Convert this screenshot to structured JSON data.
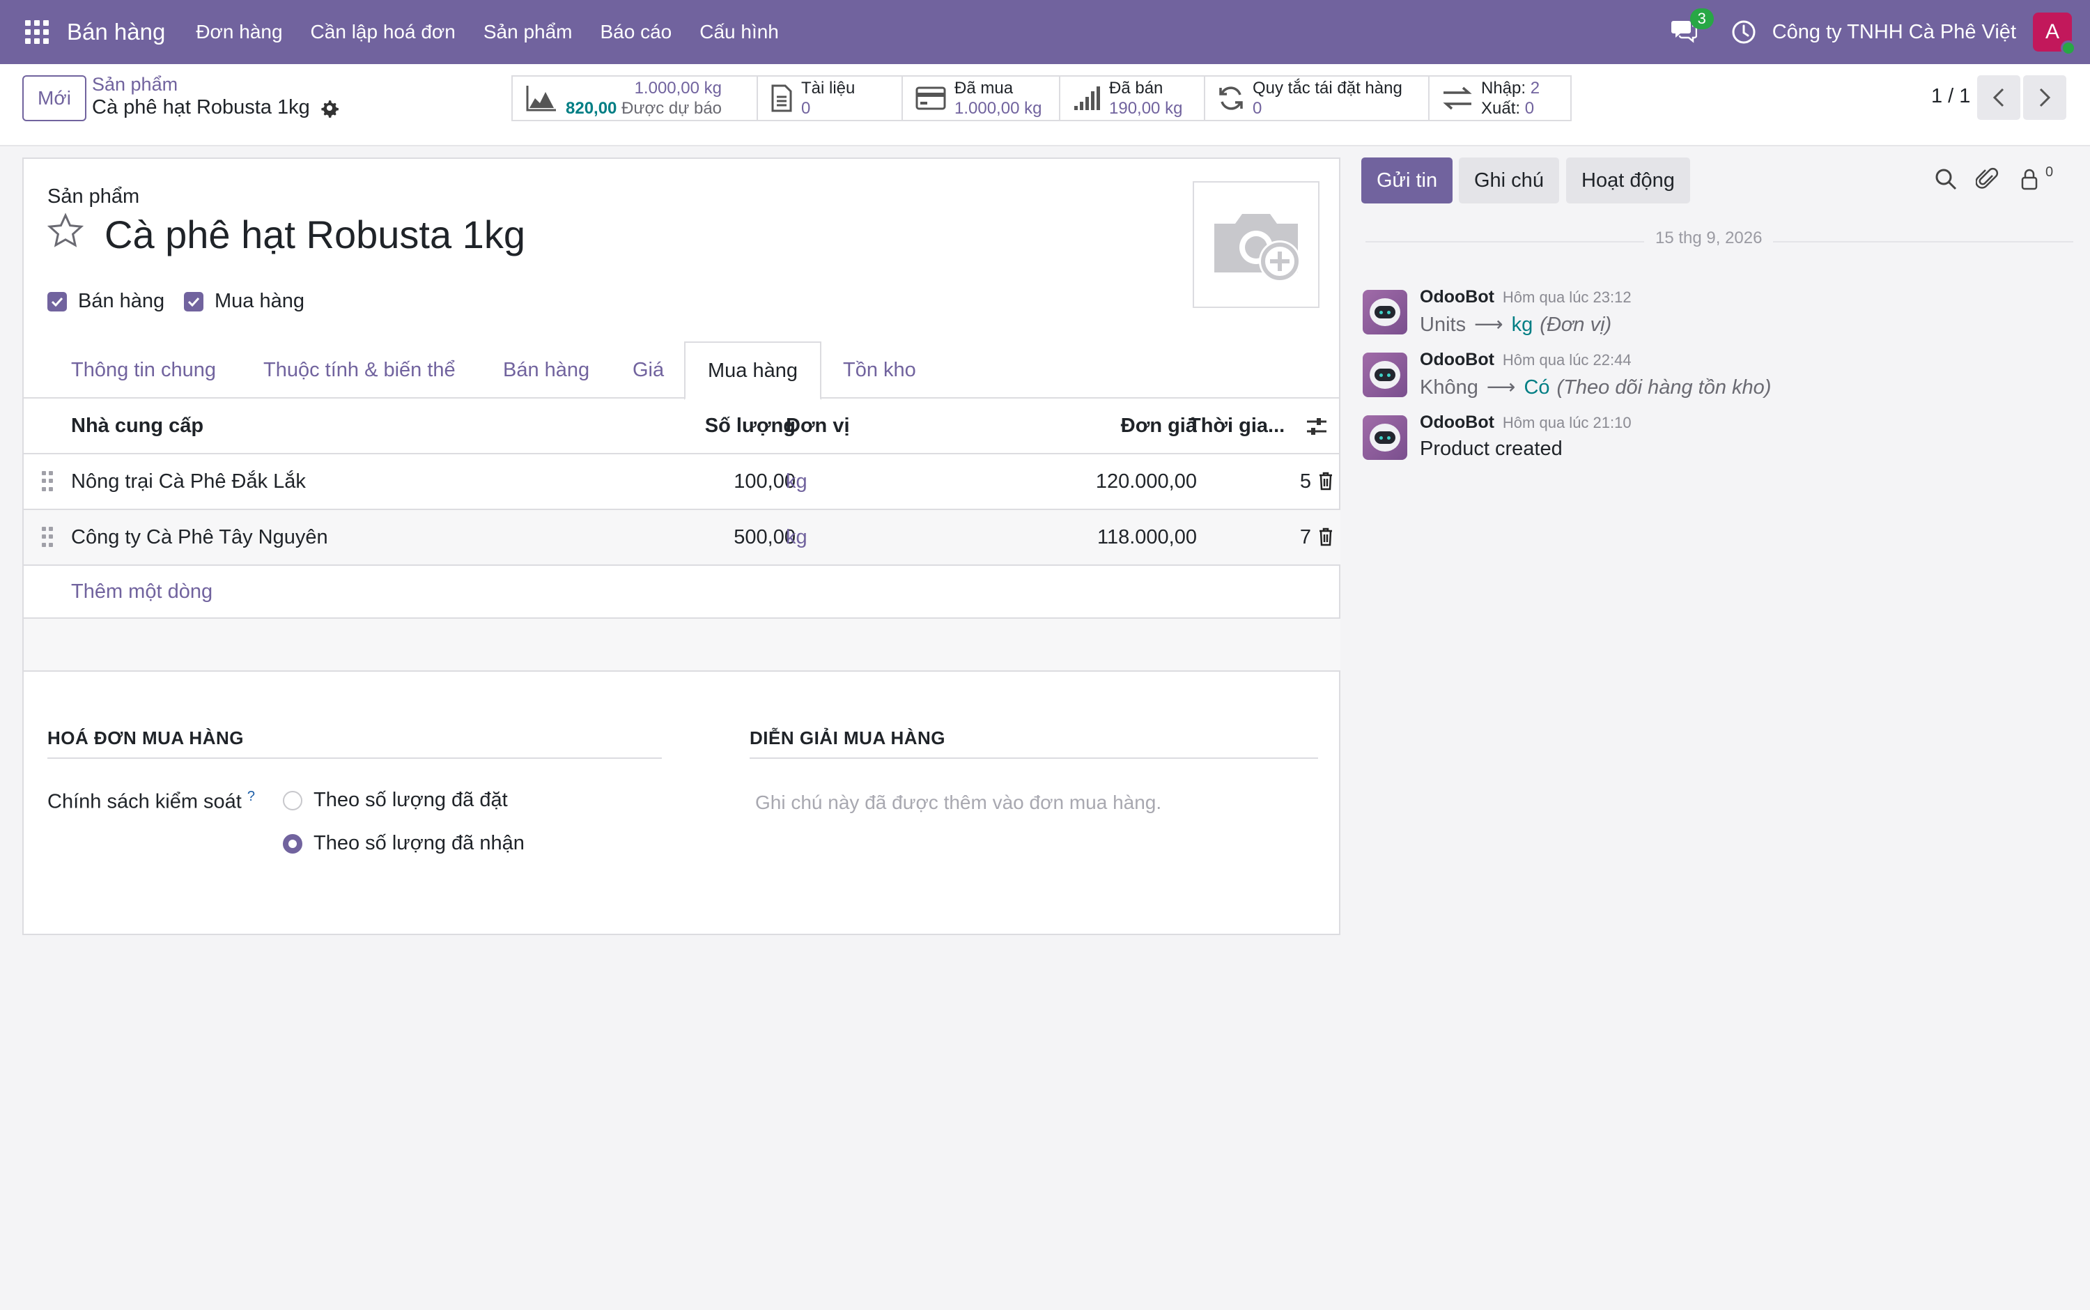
{
  "navbar": {
    "app_name": "Bán hàng",
    "menus": [
      "Đơn hàng",
      "Cần lập hoá đơn",
      "Sản phẩm",
      "Báo cáo",
      "Cấu hình"
    ],
    "message_count": "3",
    "company": "Công ty TNHH Cà Phê Việt",
    "avatar_letter": "A"
  },
  "control": {
    "new_label": "Mới",
    "breadcrumb_parent": "Sản phẩm",
    "breadcrumb_current": "Cà phê hạt Robusta 1kg",
    "smart_buttons": {
      "forecast": {
        "onhand": "1.000,00 kg",
        "forecast_value": "820,00",
        "forecast_label": "Được dự báo"
      },
      "documents": {
        "label": "Tài liệu",
        "value": "0"
      },
      "purchased": {
        "label": "Đã mua",
        "value": "1.000,00 kg"
      },
      "sold": {
        "label": "Đã bán",
        "value": "190,00 kg"
      },
      "reorder": {
        "label": "Quy tắc tái đặt hàng",
        "value": "0"
      },
      "moves": {
        "in_label": "Nhập:",
        "in_value": "2",
        "out_label": "Xuất:",
        "out_value": "0"
      }
    },
    "pager": "1 / 1"
  },
  "form": {
    "product_label": "Sản phẩm",
    "product_name": "Cà phê hạt Robusta 1kg",
    "can_be_sold_label": "Bán hàng",
    "can_be_purchased_label": "Mua hàng",
    "tabs": [
      "Thông tin chung",
      "Thuộc tính & biến thể",
      "Bán hàng",
      "Giá",
      "Mua hàng",
      "Tồn kho"
    ],
    "active_tab": "Mua hàng",
    "vendor_table": {
      "headers": {
        "vendor": "Nhà cung cấp",
        "qty": "Số lượng",
        "uom": "Đơn vị",
        "price": "Đơn giá",
        "delay": "Thời gia..."
      },
      "rows": [
        {
          "vendor": "Nông trại Cà Phê Đắk Lắk",
          "qty": "100,00",
          "uom": "kg",
          "price": "120.000,00",
          "delay": "5"
        },
        {
          "vendor": "Công ty Cà Phê Tây Nguyên",
          "qty": "500,00",
          "uom": "kg",
          "price": "118.000,00",
          "delay": "7"
        }
      ],
      "add_line": "Thêm một dòng"
    },
    "bill_section": "HOÁ ĐƠN MUA HÀNG",
    "desc_section": "DIỄN GIẢI MUA HÀNG",
    "control_policy_label": "Chính sách kiểm soát",
    "control_policy_help": "?",
    "policy_options": [
      "Theo số lượng đã đặt",
      "Theo số lượng đã nhận"
    ],
    "policy_selected": "Theo số lượng đã nhận",
    "description_placeholder": "Ghi chú này đã được thêm vào đơn mua hàng."
  },
  "chatter": {
    "send_message": "Gửi tin",
    "log_note": "Ghi chú",
    "activity": "Hoạt động",
    "followers_count": "0",
    "date": "15 thg 9, 2026",
    "messages": [
      {
        "author": "OdooBot",
        "time": "Hôm qua lúc 23:12",
        "old": "Units",
        "new": "kg",
        "field": "(Đơn vị)"
      },
      {
        "author": "OdooBot",
        "time": "Hôm qua lúc 22:44",
        "old": "Không",
        "new": "Có",
        "field": "(Theo dõi hàng tồn kho)"
      },
      {
        "author": "OdooBot",
        "time": "Hôm qua lúc 21:10",
        "text": "Product created"
      }
    ]
  },
  "colors": {
    "brand": "#71639e",
    "accent": "#017e84",
    "success": "#28a745"
  }
}
